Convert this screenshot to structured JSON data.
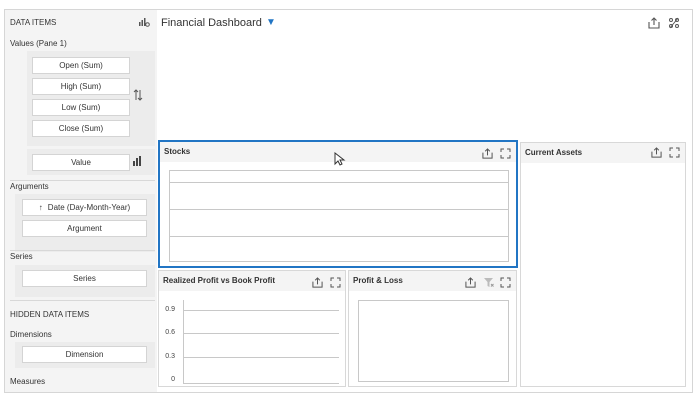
{
  "left_pane": {
    "title": "DATA ITEMS",
    "values_label": "Values (Pane 1)",
    "values": [
      "Open (Sum)",
      "High (Sum)",
      "Low (Sum)",
      "Close (Sum)"
    ],
    "value_placeholder": "Value",
    "arguments_label": "Arguments",
    "argument_item": "Date (Day-Month-Year)",
    "argument_placeholder": "Argument",
    "series_label": "Series",
    "series_placeholder": "Series",
    "hidden_title": "HIDDEN DATA ITEMS",
    "dimensions_label": "Dimensions",
    "dimension_placeholder": "Dimension",
    "measures_label": "Measures"
  },
  "dashboard": {
    "title": "Financial Dashboard"
  },
  "items": {
    "stocks": "Stocks",
    "current_assets": "Current Assets",
    "profit_vs_book": "Realized Profit vs Book Profit",
    "profit_loss": "Profit & Loss"
  },
  "chart_data": {
    "type": "line",
    "title": "Realized Profit vs Book Profit",
    "yticks": [
      "0.9",
      "0.6",
      "0.3",
      "0"
    ],
    "ylim": [
      0,
      0.9
    ],
    "series": []
  },
  "colors": {
    "accent": "#2175c4"
  }
}
